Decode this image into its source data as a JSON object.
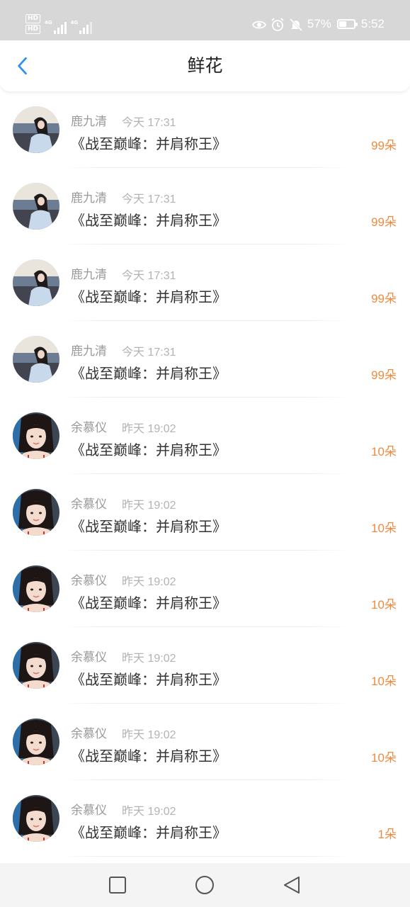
{
  "status_bar": {
    "hd1": "HD",
    "hd2": "HD",
    "sig1_label": "4G",
    "sig2_label": "4G",
    "battery_percent": "57%",
    "battery_level": 0.57,
    "time": "5:52",
    "icons": [
      "eye-icon",
      "alarm-icon",
      "mute-bell-icon",
      "battery-icon"
    ]
  },
  "header": {
    "title": "鲜花",
    "back_icon": "chevron-left-icon"
  },
  "colors": {
    "accent_blue": "#2e8ff0",
    "amount_orange": "#f08b3e",
    "status_bar_bg": "#d7d7d7"
  },
  "records": [
    {
      "name": "鹿九清",
      "time": "今天 17:31",
      "book": "《战至巅峰：并肩称王》",
      "amount": "99朵",
      "avatar": "avatar-a"
    },
    {
      "name": "鹿九清",
      "time": "今天 17:31",
      "book": "《战至巅峰：并肩称王》",
      "amount": "99朵",
      "avatar": "avatar-a"
    },
    {
      "name": "鹿九清",
      "time": "今天 17:31",
      "book": "《战至巅峰：并肩称王》",
      "amount": "99朵",
      "avatar": "avatar-a"
    },
    {
      "name": "鹿九清",
      "time": "今天 17:31",
      "book": "《战至巅峰：并肩称王》",
      "amount": "99朵",
      "avatar": "avatar-a"
    },
    {
      "name": "余慕仪",
      "time": "昨天 19:02",
      "book": "《战至巅峰：并肩称王》",
      "amount": "10朵",
      "avatar": "avatar-b"
    },
    {
      "name": "余慕仪",
      "time": "昨天 19:02",
      "book": "《战至巅峰：并肩称王》",
      "amount": "10朵",
      "avatar": "avatar-b"
    },
    {
      "name": "余慕仪",
      "time": "昨天 19:02",
      "book": "《战至巅峰：并肩称王》",
      "amount": "10朵",
      "avatar": "avatar-b"
    },
    {
      "name": "余慕仪",
      "time": "昨天 19:02",
      "book": "《战至巅峰：并肩称王》",
      "amount": "10朵",
      "avatar": "avatar-b"
    },
    {
      "name": "余慕仪",
      "time": "昨天 19:02",
      "book": "《战至巅峰：并肩称王》",
      "amount": "10朵",
      "avatar": "avatar-b"
    },
    {
      "name": "余慕仪",
      "time": "昨天 19:02",
      "book": "《战至巅峰：并肩称王》",
      "amount": "1朵",
      "avatar": "avatar-b"
    }
  ],
  "system_nav": {
    "icons": [
      "square-recent-apps-icon",
      "circle-home-icon",
      "triangle-back-icon"
    ]
  }
}
